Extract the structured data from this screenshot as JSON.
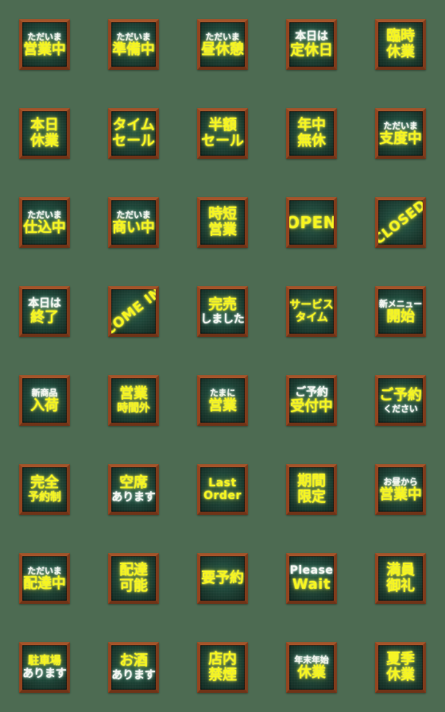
{
  "page": {
    "title": "Shop Status Sign Emoji Sheet",
    "background_color": "#4d6b52",
    "grid": {
      "columns": 5,
      "rows": 8,
      "total": 40
    },
    "tile_style": {
      "frame_color": "#93441f",
      "board_color": "#1a4437",
      "text_white": "#f4f7f2",
      "text_yellow": "#f6f520"
    }
  },
  "stickers": [
    {
      "id": 1,
      "name": "eigyochu",
      "lines": [
        {
          "text": "ただいま",
          "color": "white",
          "size": "sm"
        },
        {
          "text": "営業中",
          "color": "yellow",
          "size": "lg"
        }
      ],
      "rotated": false
    },
    {
      "id": 2,
      "name": "junbichu",
      "lines": [
        {
          "text": "ただいま",
          "color": "white",
          "size": "sm"
        },
        {
          "text": "準備中",
          "color": "yellow",
          "size": "lg"
        }
      ],
      "rotated": false
    },
    {
      "id": 3,
      "name": "hiruyasumi",
      "lines": [
        {
          "text": "ただいま",
          "color": "white",
          "size": "sm"
        },
        {
          "text": "昼休憩",
          "color": "yellow",
          "size": "lg"
        }
      ],
      "rotated": false
    },
    {
      "id": 4,
      "name": "teikyubi",
      "lines": [
        {
          "text": "本日は",
          "color": "white",
          "size": "md"
        },
        {
          "text": "定休日",
          "color": "yellow",
          "size": "lg"
        }
      ],
      "rotated": false
    },
    {
      "id": 5,
      "name": "rinji-kyugyo",
      "lines": [
        {
          "text": "臨時",
          "color": "yellow",
          "size": "lg"
        },
        {
          "text": "休業",
          "color": "yellow",
          "size": "lg"
        }
      ],
      "rotated": false
    },
    {
      "id": 6,
      "name": "honjitsu-kyugyo",
      "lines": [
        {
          "text": "本日",
          "color": "yellow",
          "size": "lg"
        },
        {
          "text": "休業",
          "color": "yellow",
          "size": "lg"
        }
      ],
      "rotated": false
    },
    {
      "id": 7,
      "name": "time-sale",
      "lines": [
        {
          "text": "タイム",
          "color": "yellow",
          "size": "lg"
        },
        {
          "text": "セール",
          "color": "yellow",
          "size": "lg"
        }
      ],
      "rotated": false
    },
    {
      "id": 8,
      "name": "hangaku-sale",
      "lines": [
        {
          "text": "半額",
          "color": "yellow",
          "size": "lg"
        },
        {
          "text": "セール",
          "color": "yellow",
          "size": "lg"
        }
      ],
      "rotated": false
    },
    {
      "id": 9,
      "name": "nenju-mukyu",
      "lines": [
        {
          "text": "年中",
          "color": "yellow",
          "size": "lg"
        },
        {
          "text": "無休",
          "color": "yellow",
          "size": "lg"
        }
      ],
      "rotated": false
    },
    {
      "id": 10,
      "name": "shitakuchu",
      "lines": [
        {
          "text": "ただいま",
          "color": "white",
          "size": "sm"
        },
        {
          "text": "支度中",
          "color": "yellow",
          "size": "lg"
        }
      ],
      "rotated": false
    },
    {
      "id": 11,
      "name": "shikomichu",
      "lines": [
        {
          "text": "ただいま",
          "color": "white",
          "size": "sm"
        },
        {
          "text": "仕込中",
          "color": "yellow",
          "size": "lg"
        }
      ],
      "rotated": false
    },
    {
      "id": 12,
      "name": "akinaichu",
      "lines": [
        {
          "text": "ただいま",
          "color": "white",
          "size": "sm"
        },
        {
          "text": "商い中",
          "color": "yellow",
          "size": "lg"
        }
      ],
      "rotated": false
    },
    {
      "id": 13,
      "name": "jitan-eigyo",
      "lines": [
        {
          "text": "時短",
          "color": "yellow",
          "size": "lg"
        },
        {
          "text": "営業",
          "color": "yellow",
          "size": "lg"
        }
      ],
      "rotated": false
    },
    {
      "id": 14,
      "name": "open",
      "lines": [
        {
          "text": "OPEN",
          "color": "yellow",
          "size": "xl"
        }
      ],
      "rotated": false,
      "latin": true
    },
    {
      "id": 15,
      "name": "closed",
      "lines": [
        {
          "text": "CLOSED",
          "color": "yellow",
          "size": "lg"
        }
      ],
      "rotated": true,
      "latin": true
    },
    {
      "id": 16,
      "name": "honjitsu-shuryo",
      "lines": [
        {
          "text": "本日は",
          "color": "white",
          "size": "md"
        },
        {
          "text": "終了",
          "color": "yellow",
          "size": "lg"
        }
      ],
      "rotated": false
    },
    {
      "id": 17,
      "name": "come-in",
      "lines": [
        {
          "text": "COME IN",
          "color": "yellow",
          "size": "lg"
        }
      ],
      "rotated": true,
      "latin": true
    },
    {
      "id": 18,
      "name": "kanbai",
      "lines": [
        {
          "text": "完売",
          "color": "yellow",
          "size": "lg"
        },
        {
          "text": "しました",
          "color": "white",
          "size": "md"
        }
      ],
      "rotated": false
    },
    {
      "id": 19,
      "name": "service-time",
      "lines": [
        {
          "text": "サービス",
          "color": "yellow",
          "size": "md"
        },
        {
          "text": "タイム",
          "color": "yellow",
          "size": "md"
        }
      ],
      "rotated": false
    },
    {
      "id": 20,
      "name": "shin-menu-kaishi",
      "lines": [
        {
          "text": "新メニュー",
          "color": "white",
          "size": "sm"
        },
        {
          "text": "開始",
          "color": "yellow",
          "size": "lg"
        }
      ],
      "rotated": false
    },
    {
      "id": 21,
      "name": "shinshohin-nyuka",
      "lines": [
        {
          "text": "新商品",
          "color": "white",
          "size": "sm"
        },
        {
          "text": "入荷",
          "color": "yellow",
          "size": "lg"
        }
      ],
      "rotated": false
    },
    {
      "id": 22,
      "name": "eigyo-jikangai",
      "lines": [
        {
          "text": "営業",
          "color": "yellow",
          "size": "lg"
        },
        {
          "text": "時間外",
          "color": "yellow",
          "size": "md"
        }
      ],
      "rotated": false
    },
    {
      "id": 23,
      "name": "tamani-eigyo",
      "lines": [
        {
          "text": "たまに",
          "color": "white",
          "size": "sm"
        },
        {
          "text": "営業",
          "color": "yellow",
          "size": "lg"
        }
      ],
      "rotated": false
    },
    {
      "id": 24,
      "name": "goyoyaku-uketsuke",
      "lines": [
        {
          "text": "ご予約",
          "color": "white",
          "size": "md"
        },
        {
          "text": "受付中",
          "color": "yellow",
          "size": "lg"
        }
      ],
      "rotated": false
    },
    {
      "id": 25,
      "name": "goyoyaku-kudasai",
      "lines": [
        {
          "text": "ご予約",
          "color": "yellow",
          "size": "lg"
        },
        {
          "text": "ください",
          "color": "white",
          "size": "sm"
        }
      ],
      "rotated": false
    },
    {
      "id": 26,
      "name": "kanzen-yoyakusei",
      "lines": [
        {
          "text": "完全",
          "color": "yellow",
          "size": "lg"
        },
        {
          "text": "予約制",
          "color": "yellow",
          "size": "md"
        }
      ],
      "rotated": false
    },
    {
      "id": 27,
      "name": "kuseki-arimasu",
      "lines": [
        {
          "text": "空席",
          "color": "yellow",
          "size": "lg"
        },
        {
          "text": "あります",
          "color": "white",
          "size": "md"
        }
      ],
      "rotated": false
    },
    {
      "id": 28,
      "name": "last-order",
      "lines": [
        {
          "text": "Last",
          "color": "yellow",
          "size": "md"
        },
        {
          "text": "Order",
          "color": "yellow",
          "size": "md"
        }
      ],
      "rotated": false,
      "latin": true
    },
    {
      "id": 29,
      "name": "kikan-gentei",
      "lines": [
        {
          "text": "期間",
          "color": "yellow",
          "size": "lg"
        },
        {
          "text": "限定",
          "color": "yellow",
          "size": "lg"
        }
      ],
      "rotated": false
    },
    {
      "id": 30,
      "name": "ohiru-kara",
      "lines": [
        {
          "text": "お昼から",
          "color": "white",
          "size": "sm"
        },
        {
          "text": "営業中",
          "color": "yellow",
          "size": "lg"
        }
      ],
      "rotated": false
    },
    {
      "id": 31,
      "name": "haitatsuchu",
      "lines": [
        {
          "text": "ただいま",
          "color": "white",
          "size": "sm"
        },
        {
          "text": "配達中",
          "color": "yellow",
          "size": "lg"
        }
      ],
      "rotated": false
    },
    {
      "id": 32,
      "name": "haitatsu-kano",
      "lines": [
        {
          "text": "配達",
          "color": "yellow",
          "size": "lg"
        },
        {
          "text": "可能",
          "color": "yellow",
          "size": "lg"
        }
      ],
      "rotated": false
    },
    {
      "id": 33,
      "name": "yo-yoyaku",
      "lines": [
        {
          "text": "要予約",
          "color": "yellow",
          "size": "lg"
        }
      ],
      "rotated": false
    },
    {
      "id": 34,
      "name": "please-wait",
      "lines": [
        {
          "text": "Please",
          "color": "white",
          "size": "md"
        },
        {
          "text": "Wait",
          "color": "yellow",
          "size": "lg"
        }
      ],
      "rotated": false,
      "latin": true
    },
    {
      "id": 35,
      "name": "manin-onrei",
      "lines": [
        {
          "text": "満員",
          "color": "yellow",
          "size": "lg"
        },
        {
          "text": "御礼",
          "color": "yellow",
          "size": "lg"
        }
      ],
      "rotated": false
    },
    {
      "id": 36,
      "name": "chushajo-arimasu",
      "lines": [
        {
          "text": "駐車場",
          "color": "yellow",
          "size": "md"
        },
        {
          "text": "あります",
          "color": "white",
          "size": "md"
        }
      ],
      "rotated": false
    },
    {
      "id": 37,
      "name": "osake-arimasu",
      "lines": [
        {
          "text": "お酒",
          "color": "yellow",
          "size": "lg"
        },
        {
          "text": "あります",
          "color": "white",
          "size": "md"
        }
      ],
      "rotated": false
    },
    {
      "id": 38,
      "name": "tennai-kinen",
      "lines": [
        {
          "text": "店内",
          "color": "yellow",
          "size": "lg"
        },
        {
          "text": "禁煙",
          "color": "yellow",
          "size": "lg"
        }
      ],
      "rotated": false
    },
    {
      "id": 39,
      "name": "nenmatsu-nenshi",
      "lines": [
        {
          "text": "年末年始",
          "color": "white",
          "size": "sm"
        },
        {
          "text": "休業",
          "color": "yellow",
          "size": "lg"
        }
      ],
      "rotated": false
    },
    {
      "id": 40,
      "name": "kaki-kyugyo",
      "lines": [
        {
          "text": "夏季",
          "color": "yellow",
          "size": "lg"
        },
        {
          "text": "休業",
          "color": "yellow",
          "size": "lg"
        }
      ],
      "rotated": false
    }
  ]
}
